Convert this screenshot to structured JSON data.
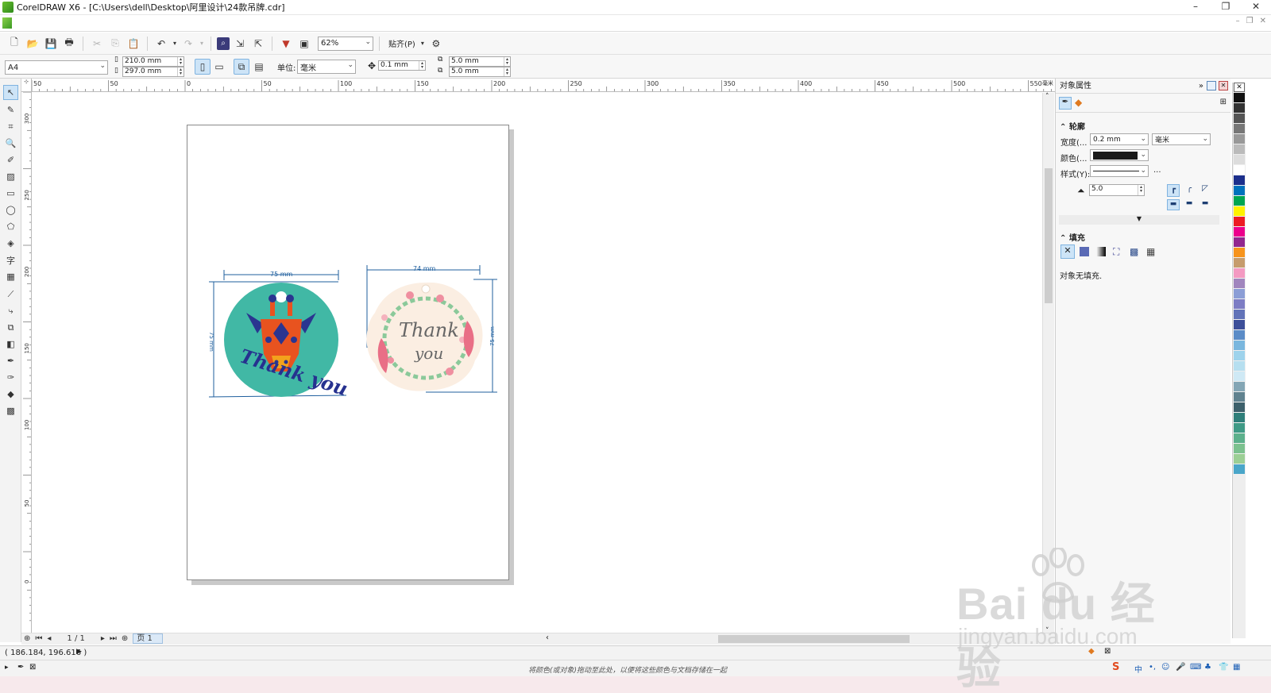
{
  "window": {
    "title": "CorelDRAW X6 - [C:\\Users\\dell\\Desktop\\阿里设计\\24款吊牌.cdr]",
    "controls": [
      "–",
      "❐",
      "✕"
    ]
  },
  "toolbar": {
    "zoom": "62%",
    "snap_label": "贴齐(P)"
  },
  "property_bar": {
    "paper_size": "A4",
    "width": "210.0 mm",
    "height": "297.0 mm",
    "unit_label": "单位:",
    "unit_value": "毫米",
    "nudge": "0.1 mm",
    "dup_x": "5.0 mm",
    "dup_y": "5.0 mm"
  },
  "ruler_h": {
    "labels": [
      "50",
      "50",
      "0",
      "50",
      "100",
      "150",
      "200",
      "250",
      "300",
      "350",
      "400",
      "450",
      "500",
      "550"
    ],
    "unit": "毫米"
  },
  "ruler_v": {
    "labels": [
      "300",
      "250",
      "200",
      "150",
      "100",
      "50",
      "0"
    ]
  },
  "artwork": {
    "tag1": {
      "width_dim": "75 mm",
      "height_dim": "75 mm",
      "text": "Thank you",
      "colors": {
        "bg": "#41b8a5",
        "face": "#e8531f",
        "horn": "#2a3590",
        "text": "#26318f"
      }
    },
    "tag2": {
      "width_dim": "74 mm",
      "height_dim": "75 mm",
      "text_line1": "Thank",
      "text_line2": "you",
      "colors": {
        "bg": "#fbeee2",
        "leaf": "#8bc99a",
        "flower": "#ef8fa0",
        "text": "#666666"
      }
    },
    "dimension_color": "#1f5f9e"
  },
  "pager": {
    "position": "1 / 1",
    "page_tab": "页 1"
  },
  "docker": {
    "title": "对象属性",
    "outline_header": "轮廓",
    "width_label": "宽度(...",
    "width_value": "0.2 mm",
    "width_unit": "毫米",
    "color_label": "颜色(...",
    "style_label": "样式(Y):",
    "style_more": "...",
    "miter_value": "5.0",
    "fill_header": "填充",
    "fill_status": "对象无填充."
  },
  "palette_colors": [
    "#111111",
    "#333333",
    "#555555",
    "#777777",
    "#999999",
    "#bbbbbb",
    "#dddddd",
    "#ffffff",
    "#1c2f8c",
    "#0072bc",
    "#00a651",
    "#fff200",
    "#ed1c24",
    "#ec008c",
    "#92278f",
    "#f7941d",
    "#c69c6d",
    "#f49ac2",
    "#a186be",
    "#8c9ed6",
    "#7d7dc4",
    "#6273b8",
    "#3d4f99",
    "#5b8cc7",
    "#7ab7de",
    "#9ed3ec",
    "#b6dff0",
    "#cfe9f5",
    "#84a6b5",
    "#60828f",
    "#3d606b",
    "#2f7f7a",
    "#3f9a86",
    "#5cb08c",
    "#7cc18f",
    "#9ccf95",
    "#4aa6c9"
  ],
  "status": {
    "coords": "( 186.184, 196.616 )",
    "hint": "将颜色(或对象)拖动至此处，以便将这些颜色与文档存储在一起"
  },
  "watermark": {
    "brand": "Bai  du 经验",
    "url": "jingyan.baidu.com"
  }
}
